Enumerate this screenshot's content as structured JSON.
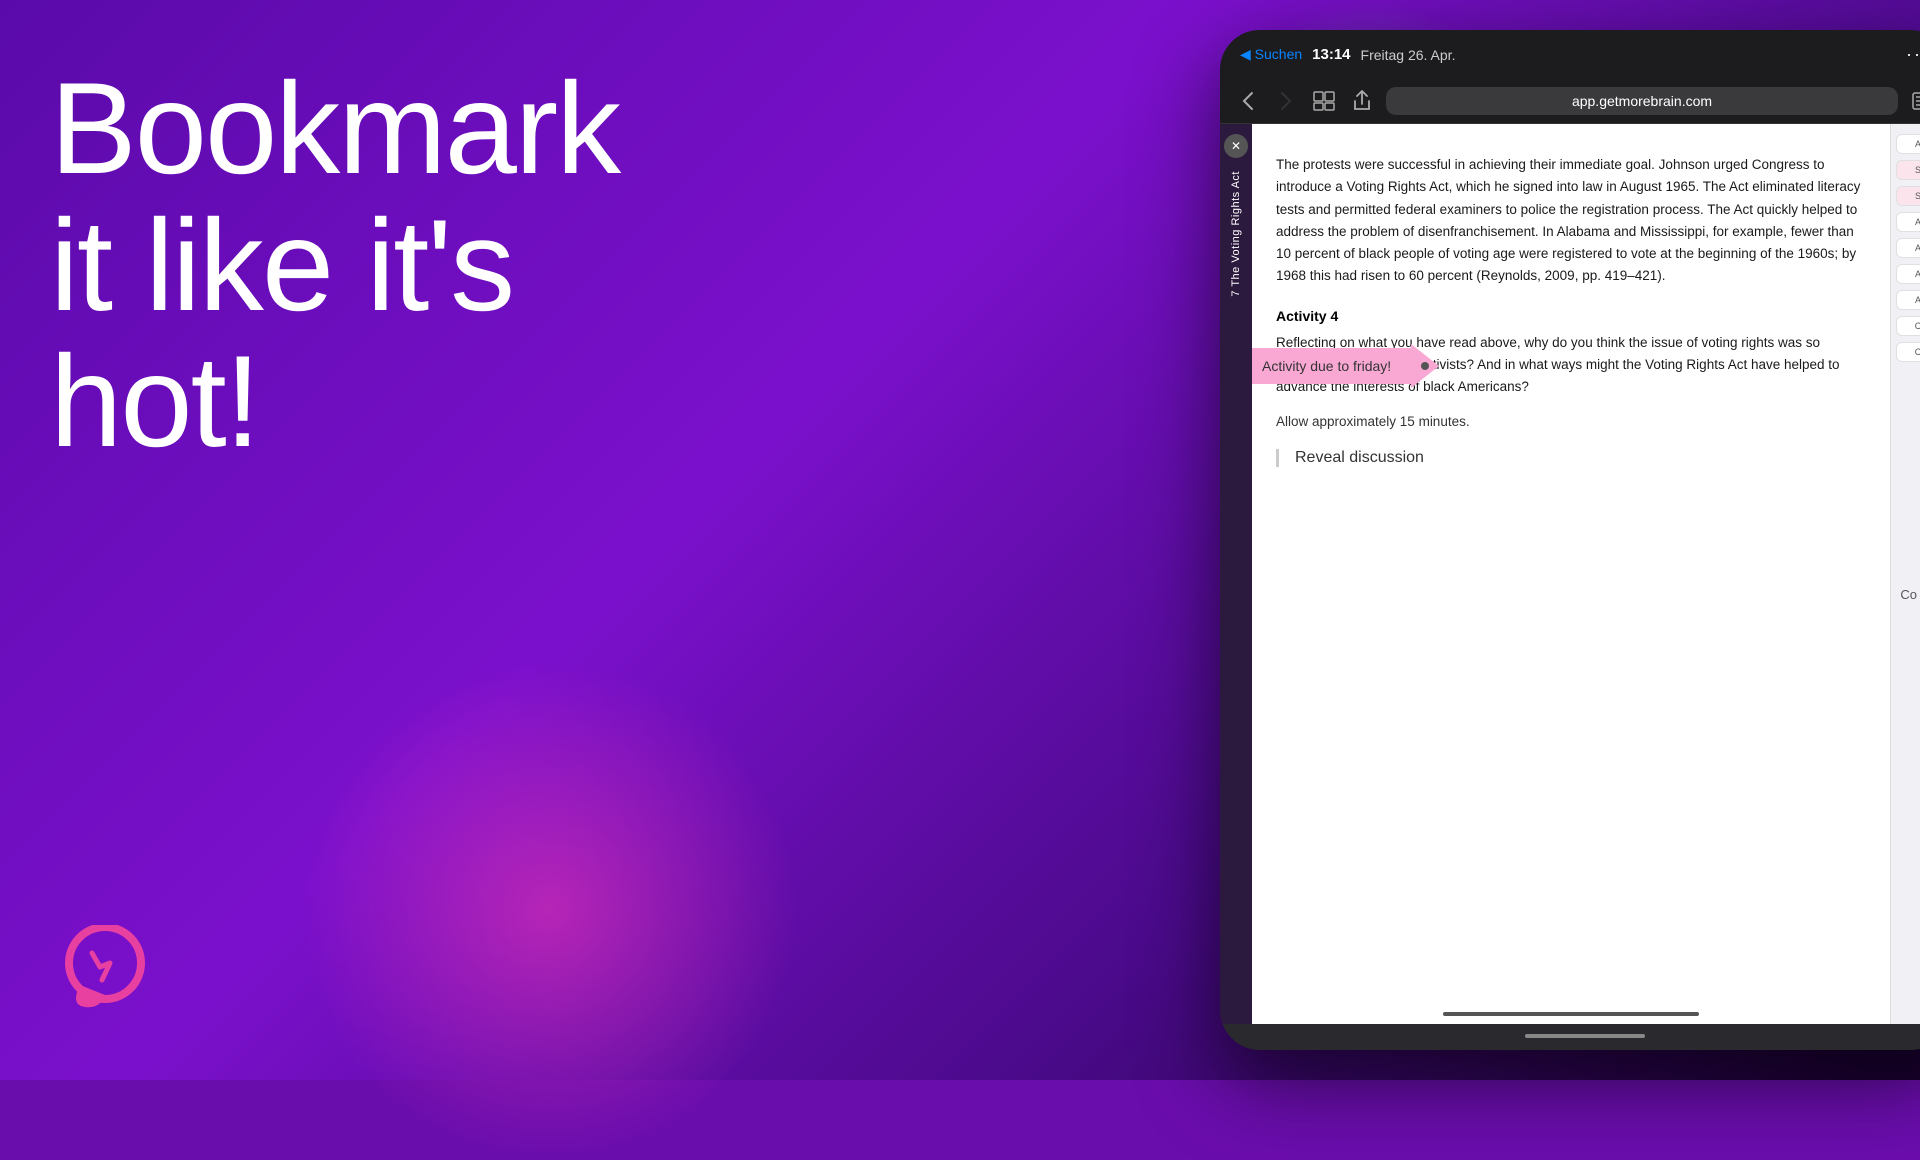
{
  "background": {
    "base_color": "#6a0dad"
  },
  "left": {
    "title_line1": "Bookmark",
    "title_line2": "it like it's",
    "title_line3": "hot!"
  },
  "tablet": {
    "status_bar": {
      "back_label": "◀ Suchen",
      "time": "13:14",
      "date": "Freitag 26. Apr.",
      "dots": "···"
    },
    "toolbar": {
      "url": "app.getmorebrain.com",
      "back_icon": "‹",
      "forward_icon": "›",
      "books_icon": "⊞",
      "share_icon": "↑",
      "list_icon": "≡"
    },
    "sidebar": {
      "close_icon": "✕",
      "label": "7 The Voting Rights Act"
    },
    "document": {
      "paragraph": "The protests were successful in achieving their immediate goal. Johnson urged Congress to introduce a Voting Rights Act, which he signed into law in August 1965. The Act eliminated literacy tests and permitted federal examiners to police the registration process. The Act quickly helped to address the problem of disenfranchisement. In Alabama and Mississippi, for example, fewer than 10 percent of black people of voting age were registered to vote at the beginning of the 1960s; by 1968 this had risen to 60 percent (Reynolds, 2009, pp. 419–421).",
      "bookmark_label": "Activity due to friday!",
      "activity_heading": "Activity 4",
      "activity_text": "Reflecting on what you have read above, why do you think the issue of voting rights was so important for civil rights activists? And in what ways might the Voting Rights Act have helped to advance the interests of black Americans?",
      "allow_text": "Allow approximately 15 minutes.",
      "reveal_label": "Reveal discussion"
    },
    "right_panel": {
      "items": [
        "Ad",
        "Se",
        "Sa",
        "Ad",
        "Ad",
        "Ad",
        "Ad",
        "Co",
        "Co"
      ]
    }
  },
  "logo": {
    "aria": "Brain.fm or GetMoreBrain logo"
  },
  "co_edge": "Co"
}
